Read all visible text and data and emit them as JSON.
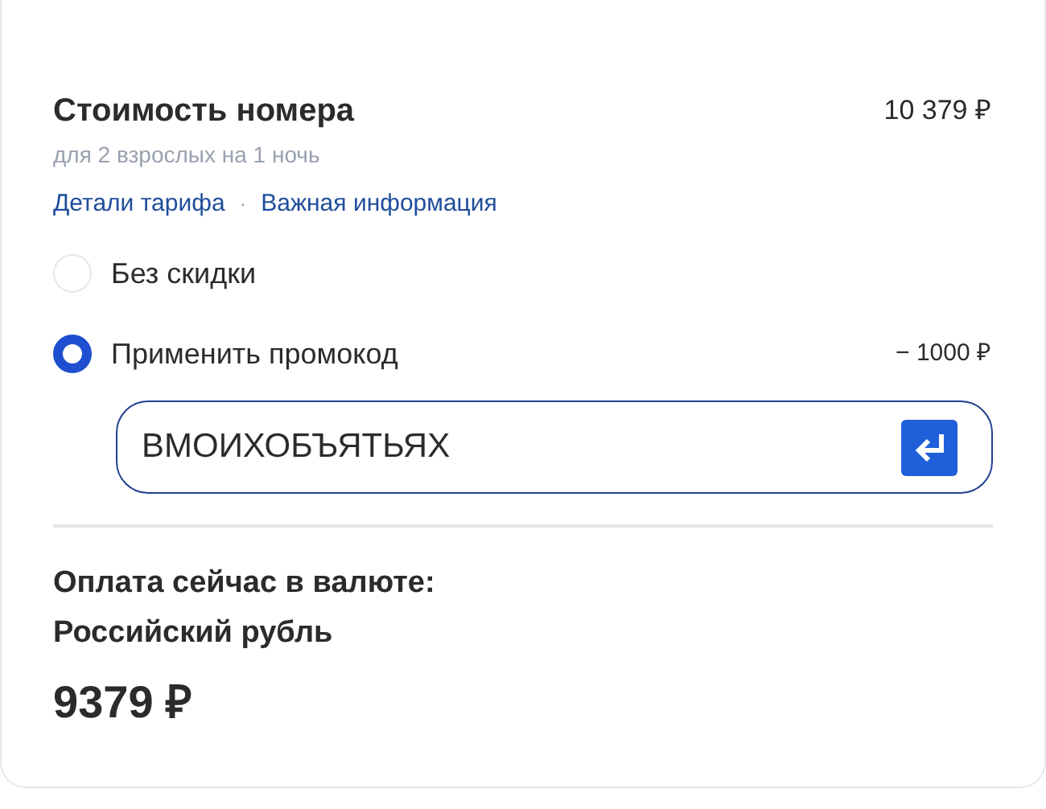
{
  "room_cost": {
    "title": "Стоимость номера",
    "price": "10 379 ₽",
    "subtitle": "для 2 взрослых на 1 ночь",
    "links": [
      "Детали тарифа",
      "Важная информация"
    ],
    "separator": "·"
  },
  "discount_options": [
    {
      "label": "Без скидки",
      "selected": false
    },
    {
      "label": "Применить промокод",
      "selected": true,
      "amount": "− 1000 ₽"
    }
  ],
  "promo_field": {
    "value": "ВМОИХОБЪЯТЬЯХ"
  },
  "payment": {
    "title": "Оплата сейчас в валюте:",
    "currency": "Российский рубль",
    "total": "9379 ₽"
  }
}
